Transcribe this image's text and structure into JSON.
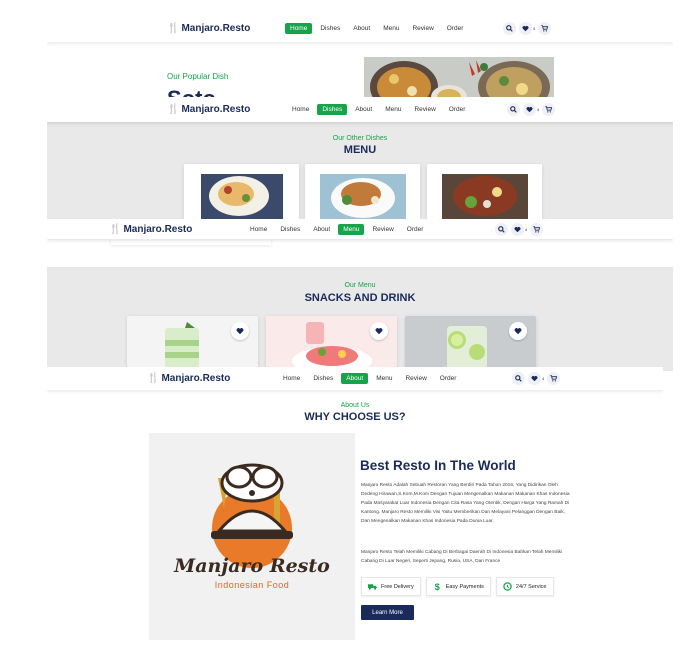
{
  "brand": {
    "name": "Manjaro.Resto"
  },
  "nav": {
    "home": "Home",
    "dishes": "Dishes",
    "about": "About",
    "menu": "Menu",
    "review": "Review",
    "order": "Order",
    "cart_count": "4"
  },
  "hero": {
    "subtitle": "Our Popular Dish",
    "title": "Soto"
  },
  "dishes_section": {
    "subtitle": "Our Other Dishes",
    "title": "MENU"
  },
  "snacks_section": {
    "subtitle": "Our Menu",
    "title": "SNACKS AND DRINK"
  },
  "about_section": {
    "subtitle": "About Us",
    "title": "WHY CHOOSE US?",
    "heading": "Best Resto In The World",
    "para1": "Manjaro Resto Adalah Sebuah Restoran Yang Berdiri Pada Tahun 2016, Yang Didirikan Oleh Dedeng Hirawan,S.Kom,M.Kom Dengan Tujuan Mengenalkan Makanan Makanan Khas Indonesia Pada Masyarakat Luar Indonesia Dengan Cita Rasa Yang Otentik, Dengan Harga Yang Ramah Di Kantong. Manjaro Resto Memiliki Visi Yaitu Memberikan Dan Melayani Pelanggan Dengan Baik, Dan Mengenalkan Makanan Khas Indonesia Pada Dunia Luar.",
    "para2": "Manjaro Resto Telah Memiliki Cabang Di Berbagai Daerah Di Indonesia Bahkan Telah Memiliki Cabang Di Luar Negeri, Seperti Jepang, Rusia, USA, Dan France",
    "features": [
      "Free Delivery",
      "Easy Payments",
      "24/7 Service"
    ],
    "button": "Learn More",
    "logo_title": "Manjaro Resto",
    "logo_sub": "Indonesian Food"
  },
  "colors": {
    "accent": "#16a34a",
    "navy": "#1a2b5b",
    "gray_bg": "#e9e9e9"
  }
}
